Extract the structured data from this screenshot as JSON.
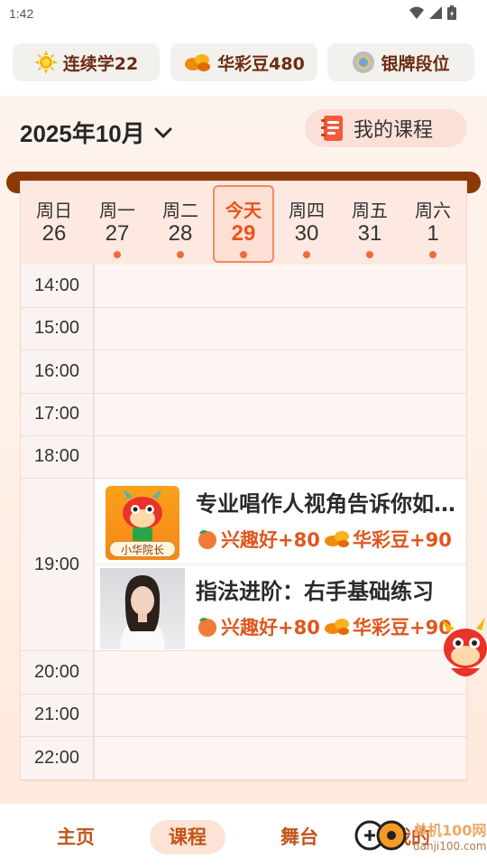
{
  "status": {
    "time": "1:42"
  },
  "stats": [
    {
      "label": "连续学22",
      "icon": "sun-icon"
    },
    {
      "label": "华彩豆480",
      "icon": "beans-icon"
    },
    {
      "label": "银牌段位",
      "icon": "medal-icon"
    }
  ],
  "header": {
    "month": "2025年10月",
    "my_courses": "我的课程"
  },
  "week": [
    {
      "name": "周日",
      "num": "26",
      "dot": false
    },
    {
      "name": "周一",
      "num": "27",
      "dot": true
    },
    {
      "name": "周二",
      "num": "28",
      "dot": true
    },
    {
      "name": "今天",
      "num": "29",
      "dot": true,
      "today": true
    },
    {
      "name": "周四",
      "num": "30",
      "dot": true
    },
    {
      "name": "周五",
      "num": "31",
      "dot": true
    },
    {
      "name": "周六",
      "num": "1",
      "dot": true
    }
  ],
  "times": [
    "14:00",
    "15:00",
    "16:00",
    "17:00",
    "18:00",
    "19:00",
    "20:00",
    "21:00",
    "22:00"
  ],
  "courses": [
    {
      "title": "专业唱作人视角告诉你如何写歌",
      "thumb_label": "小华院长",
      "rewards": [
        "兴趣好+80",
        "华彩豆+90"
      ]
    },
    {
      "title": "指法进阶：右手基础练习",
      "rewards": [
        "兴趣好+80",
        "华彩豆+90"
      ]
    }
  ],
  "nav": {
    "home": "主页",
    "courses": "课程",
    "stage": "舞台",
    "mine": "我的"
  },
  "watermark": {
    "text": "danji100.com",
    "brand": "单机100网"
  },
  "colors": {
    "accent": "#e8541f",
    "rail": "#8a3a07",
    "nav_text": "#c0551a"
  }
}
